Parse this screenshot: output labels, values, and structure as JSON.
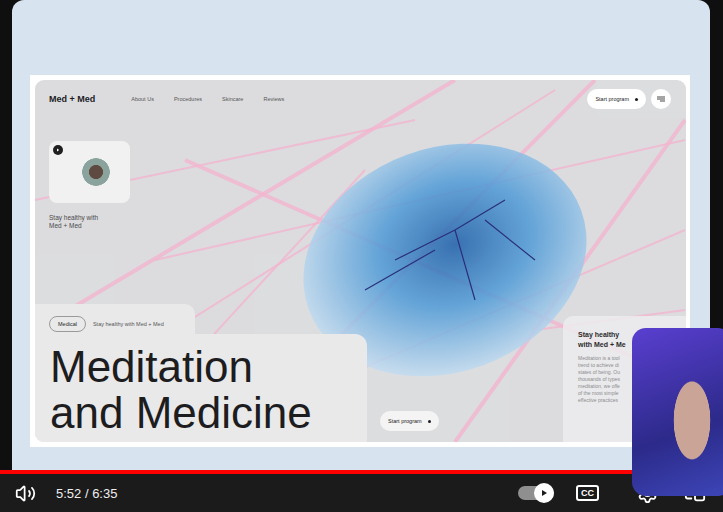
{
  "player": {
    "time": "5:52 / 6:35",
    "progress": {
      "level": 0.98
    },
    "autoplay": {
      "on": true
    },
    "captions": {
      "label": "CC"
    }
  },
  "site": {
    "logo": "Med + Med",
    "nav": [
      "About Us",
      "Procedures",
      "Skincare",
      "Reviews"
    ],
    "header_button": {
      "label": "Start program"
    },
    "promo_card": {
      "caption": [
        "Stay healthy with",
        "Med + Med"
      ]
    },
    "tag": "Medical",
    "tagline": "Stay healthy with Med + Med",
    "headline": [
      "Meditation",
      "and Medicine"
    ],
    "cta": {
      "label": "Start program"
    },
    "info_card": {
      "title": [
        "Stay healthy",
        "with Med + Me"
      ],
      "lines": [
        "Meditation is a tool",
        "trend to achieve di",
        "states of being. Ou",
        "thousands of types",
        "meditation, we offe",
        "of the most simple",
        "effective practices"
      ]
    }
  }
}
